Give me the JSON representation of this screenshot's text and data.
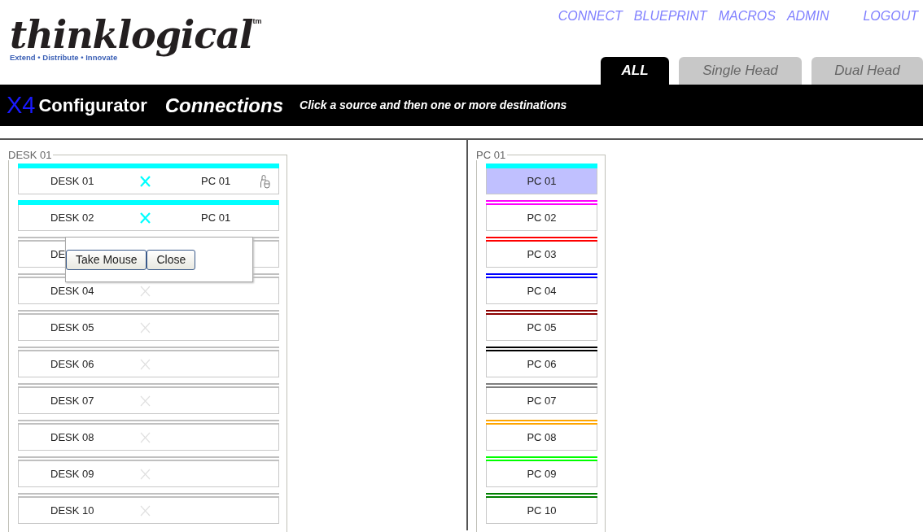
{
  "logo": {
    "name": "thinklogical",
    "trademark": "tm",
    "tagline": "Extend • Distribute • Innovate"
  },
  "nav": [
    "CONNECT",
    "BLUEPRINT",
    "MACROS",
    "ADMIN"
  ],
  "logout": "LOGOUT",
  "tabs": [
    {
      "label": "ALL",
      "selected": true
    },
    {
      "label": "Single Head",
      "selected": false
    },
    {
      "label": "Dual Head",
      "selected": false
    }
  ],
  "title_bar": {
    "product_prefix": "X4",
    "product": "Configurator",
    "page": "Connections",
    "instruction": "Click a source and then one or more destinations"
  },
  "desks": {
    "legend": "DESK 01",
    "items": [
      {
        "label": "DESK 01",
        "connected": true,
        "color": "#00ffff",
        "target": "PC 01",
        "locked": true
      },
      {
        "label": "DESK 02",
        "connected": true,
        "color": "#00ffff",
        "target": "PC 01",
        "locked": false
      },
      {
        "label": "DE",
        "connected": false,
        "locked": false,
        "menu": {
          "buttons": [
            "Take Mouse",
            "Close"
          ]
        }
      },
      {
        "label": "DESK 04",
        "connected": false,
        "locked": false
      },
      {
        "label": "DESK 05",
        "connected": false,
        "locked": false
      },
      {
        "label": "DESK 06",
        "connected": false,
        "locked": false
      },
      {
        "label": "DESK 07",
        "connected": false,
        "locked": false
      },
      {
        "label": "DESK 08",
        "connected": false,
        "locked": false
      },
      {
        "label": "DESK 09",
        "connected": false,
        "locked": false
      },
      {
        "label": "DESK 10",
        "connected": false,
        "locked": false
      }
    ]
  },
  "pcs": {
    "legend": "PC 01",
    "items": [
      {
        "label": "PC 01",
        "color": "#00ffff",
        "selected": true
      },
      {
        "label": "PC 02",
        "color": "#ff00ff",
        "selected": false
      },
      {
        "label": "PC 03",
        "color": "#ff0000",
        "selected": false
      },
      {
        "label": "PC 04",
        "color": "#0000ff",
        "selected": false
      },
      {
        "label": "PC 05",
        "color": "#8b0000",
        "selected": false
      },
      {
        "label": "PC 06",
        "color": "#000000",
        "selected": false
      },
      {
        "label": "PC 07",
        "color": "#808080",
        "selected": false
      },
      {
        "label": "PC 08",
        "color": "#ffa500",
        "selected": false
      },
      {
        "label": "PC 09",
        "color": "#00ff00",
        "selected": false
      },
      {
        "label": "PC 10",
        "color": "#008000",
        "selected": false
      }
    ]
  }
}
